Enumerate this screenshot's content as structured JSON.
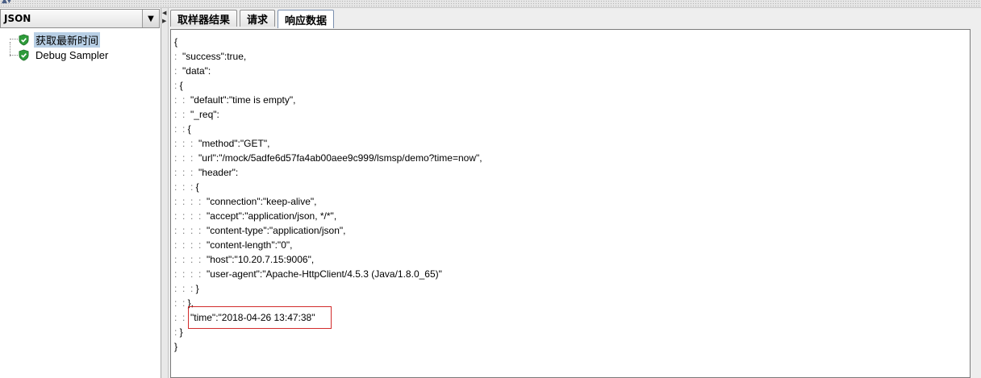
{
  "left_panel": {
    "combo_value": "JSON",
    "tree": [
      {
        "label": "获取最新时间",
        "selected": true
      },
      {
        "label": "Debug Sampler",
        "selected": false
      }
    ]
  },
  "tabs": [
    {
      "label": "取样器结果",
      "active": false
    },
    {
      "label": "请求",
      "active": false
    },
    {
      "label": "响应数据",
      "active": true
    }
  ],
  "response_lines": [
    {
      "guide": "",
      "text": "{"
    },
    {
      "guide": ": ",
      "text": " \"success\":true,"
    },
    {
      "guide": ": ",
      "text": " \"data\":"
    },
    {
      "guide": ": ",
      "text": "{"
    },
    {
      "guide": ":  : ",
      "text": " \"default\":\"time is empty\","
    },
    {
      "guide": ":  : ",
      "text": " \"_req\":"
    },
    {
      "guide": ":  : ",
      "text": "{"
    },
    {
      "guide": ":  :  : ",
      "text": " \"method\":\"GET\","
    },
    {
      "guide": ":  :  : ",
      "text": " \"url\":\"/mock/5adfe6d57fa4ab00aee9c999/lsmsp/demo?time=now\","
    },
    {
      "guide": ":  :  : ",
      "text": " \"header\":"
    },
    {
      "guide": ":  :  : ",
      "text": "{"
    },
    {
      "guide": ":  :  :  : ",
      "text": " \"connection\":\"keep-alive\","
    },
    {
      "guide": ":  :  :  : ",
      "text": " \"accept\":\"application/json, */*\","
    },
    {
      "guide": ":  :  :  : ",
      "text": " \"content-type\":\"application/json\","
    },
    {
      "guide": ":  :  :  : ",
      "text": " \"content-length\":\"0\","
    },
    {
      "guide": ":  :  :  : ",
      "text": " \"host\":\"10.20.7.15:9006\","
    },
    {
      "guide": ":  :  :  : ",
      "text": " \"user-agent\":\"Apache-HttpClient/4.5.3 (Java/1.8.0_65)\""
    },
    {
      "guide": ":  :  : ",
      "text": "}"
    },
    {
      "guide": ":  : ",
      "text": "},"
    },
    {
      "guide": ":  : ",
      "text": " \"time\":\"2018-04-26 13:47:38\""
    },
    {
      "guide": ": ",
      "text": "}"
    },
    {
      "guide": "",
      "text": "}"
    }
  ],
  "colors": {
    "highlight_border": "#d22b2b",
    "selection": "#b8cfe5",
    "shield_green": "#2e9b3a"
  }
}
